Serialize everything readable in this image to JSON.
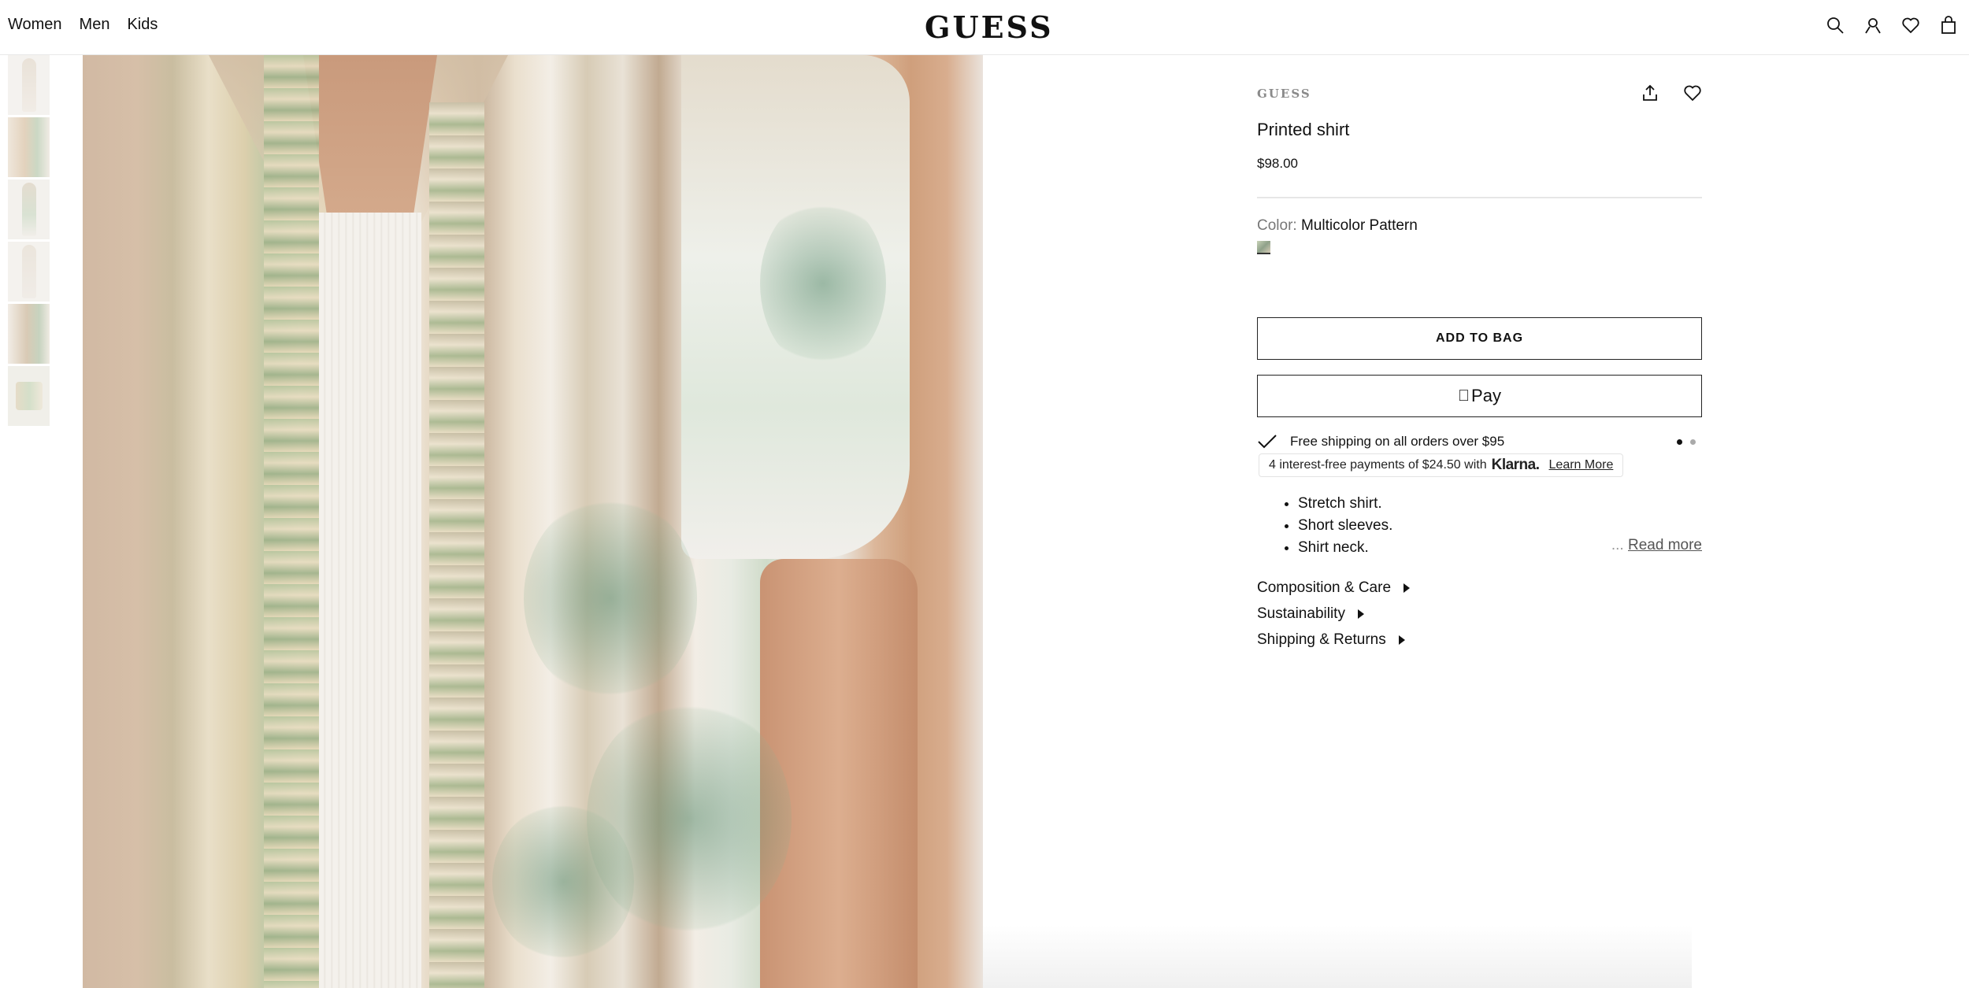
{
  "header": {
    "nav": [
      "Women",
      "Men",
      "Kids"
    ],
    "logo": "GUESS",
    "icons": [
      "search-icon",
      "account-icon",
      "wishlist-heart-icon",
      "shopping-bag-icon"
    ]
  },
  "gallery": {
    "thumbnails": 6,
    "main_image_alt": "Printed shirt"
  },
  "product": {
    "brand": "GUESS",
    "title": "Printed shirt",
    "price": "$98.00",
    "color_label": "Color:",
    "color_value": "Multicolor Pattern",
    "add_to_bag": "ADD TO BAG",
    "apple_pay_label": "Pay",
    "shipping_text": "Free shipping on all orders over $95",
    "klarna": {
      "prefix": "4 interest-free payments of $24.50 with",
      "brand": "Klarna.",
      "link": "Learn More"
    },
    "bullets": [
      "Stretch shirt.",
      "Short sleeves.",
      "Shirt neck."
    ],
    "read_more_prefix": "...",
    "read_more": "Read more",
    "accordions": [
      "Composition & Care",
      "Sustainability",
      "Shipping & Returns"
    ]
  },
  "colors": {
    "text": "#111111",
    "muted": "#777777",
    "border": "#222222",
    "divider": "#e6e6e6"
  }
}
